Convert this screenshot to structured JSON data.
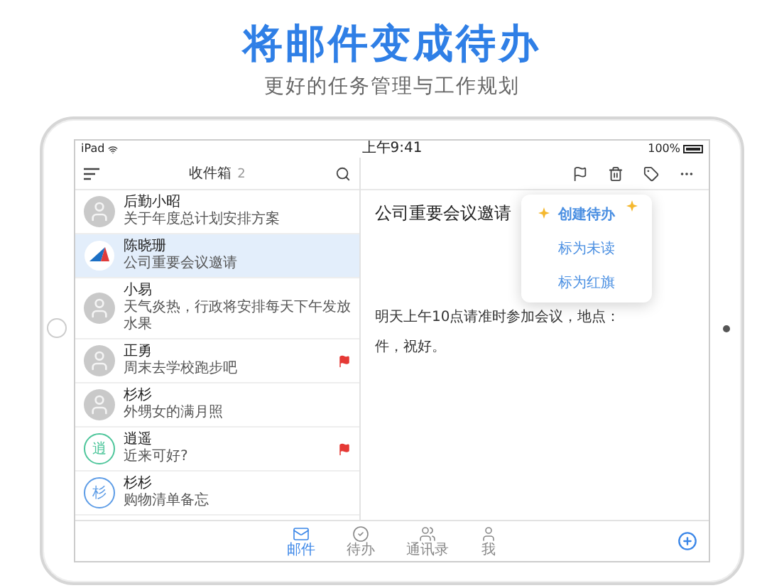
{
  "headline": "将邮件变成待办",
  "subheadline": "更好的任务管理与工作规划",
  "status_bar": {
    "device": "iPad",
    "time": "上午9:41",
    "battery": "100%"
  },
  "mail_list": {
    "title": "收件箱",
    "count": "2",
    "items": [
      {
        "sender": "后勤小昭",
        "subject": "关于年度总计划安排方案",
        "avatar": {
          "kind": "photo"
        },
        "flagged": false,
        "selected": false
      },
      {
        "sender": "陈晓珊",
        "subject": "公司重要会议邀请",
        "avatar": {
          "kind": "logo"
        },
        "flagged": false,
        "selected": true
      },
      {
        "sender": "小易",
        "subject": "天气炎热，行政将安排每天下午发放水果",
        "avatar": {
          "kind": "photo"
        },
        "flagged": false,
        "selected": false
      },
      {
        "sender": "正勇",
        "subject": "周末去学校跑步吧",
        "avatar": {
          "kind": "photo"
        },
        "flagged": true,
        "selected": false
      },
      {
        "sender": "杉杉",
        "subject": "外甥女的满月照",
        "avatar": {
          "kind": "photo"
        },
        "flagged": false,
        "selected": false
      },
      {
        "sender": "逍遥",
        "subject": "近来可好?",
        "avatar": {
          "kind": "letter",
          "letter": "逍",
          "color": "#4cc59a"
        },
        "flagged": true,
        "selected": false
      },
      {
        "sender": "杉杉",
        "subject": "购物清单备忘",
        "avatar": {
          "kind": "letter",
          "letter": "杉",
          "color": "#5b9be6"
        },
        "flagged": false,
        "selected": false
      }
    ]
  },
  "message": {
    "subject": "公司重要会议邀请",
    "body_start": "明天上午10点请准时参加会议，地点：",
    "body_end": "件，祝好。"
  },
  "popup_menu": [
    {
      "label": "创建待办",
      "highlighted": true
    },
    {
      "label": "标为未读",
      "highlighted": false
    },
    {
      "label": "标为红旗",
      "highlighted": false
    }
  ],
  "tabs": [
    {
      "kind": "mail",
      "label": "邮件",
      "selected": true
    },
    {
      "kind": "todo",
      "label": "待办",
      "selected": false
    },
    {
      "kind": "contacts",
      "label": "通讯录",
      "selected": false
    },
    {
      "kind": "me",
      "label": "我",
      "selected": false
    }
  ]
}
